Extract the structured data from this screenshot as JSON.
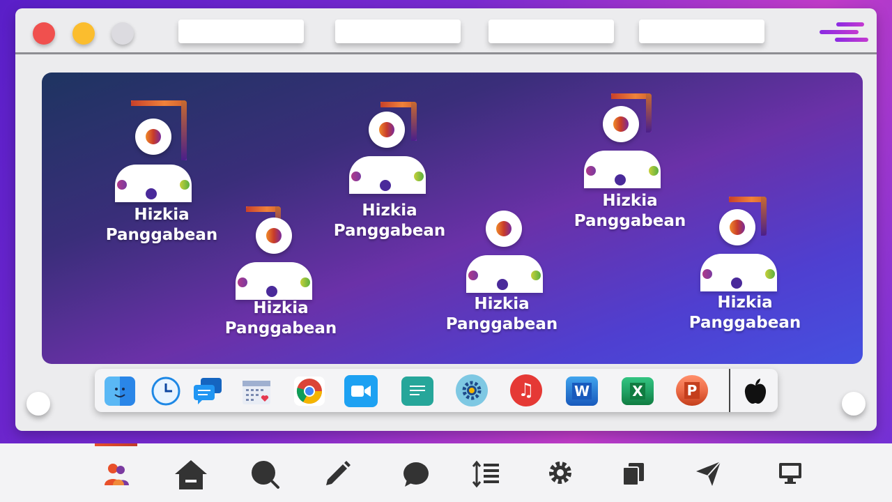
{
  "window": {
    "traffic_lights": [
      "close",
      "minimize",
      "zoom"
    ],
    "tabs": [
      "",
      "",
      "",
      ""
    ],
    "menu_icon": "menu-lines-icon"
  },
  "stage": {
    "people": [
      {
        "name_line1": "Hizkia",
        "name_line2": "Panggabean"
      },
      {
        "name_line1": "Hizkia",
        "name_line2": "Panggabean"
      },
      {
        "name_line1": "Hizkia",
        "name_line2": "Panggabean"
      },
      {
        "name_line1": "Hizkia",
        "name_line2": "Panggabean"
      },
      {
        "name_line1": "Hizkia",
        "name_line2": "Panggabean"
      },
      {
        "name_line1": "Hizkia",
        "name_line2": "Panggabean"
      }
    ]
  },
  "dock": {
    "apps": [
      {
        "icon": "finder-icon"
      },
      {
        "icon": "clock-icon"
      },
      {
        "icon": "messages-icon"
      },
      {
        "icon": "calendar-icon"
      },
      {
        "icon": "chrome-icon"
      },
      {
        "icon": "zoom-video-icon"
      },
      {
        "icon": "chat-icon"
      },
      {
        "icon": "settings-icon"
      },
      {
        "icon": "music-icon",
        "glyph": "♫"
      },
      {
        "icon": "word-icon",
        "glyph": "W"
      },
      {
        "icon": "excel-icon",
        "glyph": "X"
      },
      {
        "icon": "powerpoint-icon",
        "glyph": "P"
      },
      {
        "icon": "apple-icon"
      }
    ]
  },
  "bottom_nav": {
    "items": [
      {
        "icon": "users-icon",
        "active": true
      },
      {
        "icon": "home-icon"
      },
      {
        "icon": "search-icon"
      },
      {
        "icon": "pencil-icon"
      },
      {
        "icon": "chat-bubble-icon"
      },
      {
        "icon": "sort-lines-icon"
      },
      {
        "icon": "gear-icon"
      },
      {
        "icon": "files-icon"
      },
      {
        "icon": "send-icon"
      },
      {
        "icon": "monitor-icon"
      }
    ]
  },
  "colors": {
    "accent": "#e8502a",
    "stage_from": "#1e3461",
    "stage_to": "#4550e0"
  }
}
